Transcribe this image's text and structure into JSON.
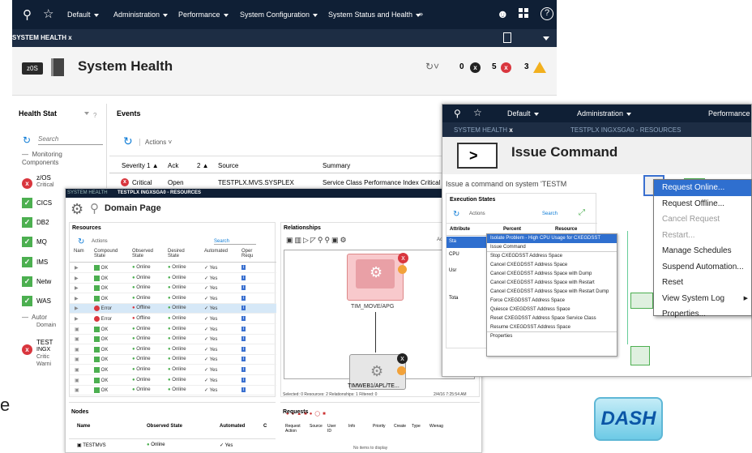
{
  "nav": {
    "default": "Default",
    "administration": "Administration",
    "performance": "Performance",
    "system_configuration": "System Configuration",
    "system_status": "System Status and Health",
    "more": "»",
    "help": "?"
  },
  "tab": {
    "label": "SYSTEM HEALTH",
    "close": "x"
  },
  "header": {
    "os_badge": "z0S",
    "title": "System Health",
    "count_crit": "0",
    "count_err": "5",
    "count_warn": "3"
  },
  "health_states": {
    "title": "Health Stat",
    "search_placeholder": "Search",
    "items": [
      {
        "label": "Monitoring Components"
      },
      {
        "label": "z/OS",
        "sub": "Critical"
      },
      {
        "label": "CICS"
      },
      {
        "label": "DB2"
      },
      {
        "label": "MQ"
      },
      {
        "label": "IMS"
      },
      {
        "label": "Netw"
      },
      {
        "label": "WAS"
      },
      {
        "label": "Autor",
        "sub": "Domain"
      },
      {
        "label": "TEST",
        "sub": "INGX",
        "sub2": "Critic",
        "sub3": "Warni"
      }
    ]
  },
  "events": {
    "title": "Events",
    "actions": "Actions",
    "headers": [
      "Severity 1",
      "Ack",
      "2",
      "Source",
      "Summary"
    ],
    "row": {
      "severity": "Critical",
      "ack": "Open",
      "source": "TESTPLX.MVS.SYSPLEX",
      "summary": "Service Class Performance Index Critical"
    }
  },
  "domain": {
    "tab1": "SYSTEM HEALTH",
    "tab2": "TESTPLX INGXSGA0 - RESOURCES",
    "title": "Domain Page",
    "resources": {
      "title": "Resources",
      "actions": "Actions",
      "search": "Search",
      "headers": [
        "Nam",
        "Compound State",
        "Observed State",
        "Desired State",
        "Automated",
        "Oper Requ"
      ],
      "rows": [
        {
          "c": "OK",
          "o": "Online",
          "d": "Online",
          "a": "Yes"
        },
        {
          "c": "OK",
          "o": "Online",
          "d": "Online",
          "a": "Yes"
        },
        {
          "c": "OK",
          "o": "Online",
          "d": "Online",
          "a": "Yes"
        },
        {
          "c": "OK",
          "o": "Online",
          "d": "Online",
          "a": "Yes"
        },
        {
          "c": "Error",
          "o": "Offline",
          "d": "Online",
          "a": "Yes",
          "sel": true
        },
        {
          "c": "Error",
          "o": "Offline",
          "d": "Online",
          "a": "Yes"
        },
        {
          "c": "OK",
          "o": "Online",
          "d": "Online",
          "a": "Yes"
        },
        {
          "c": "OK",
          "o": "Online",
          "d": "Online",
          "a": "Yes"
        },
        {
          "c": "OK",
          "o": "Online",
          "d": "Online",
          "a": "Yes"
        },
        {
          "c": "OK",
          "o": "Online",
          "d": "Online",
          "a": "Yes"
        },
        {
          "c": "OK",
          "o": "Online",
          "d": "Online",
          "a": "Yes"
        },
        {
          "c": "OK",
          "o": "Online",
          "d": "Online",
          "a": "Yes"
        },
        {
          "c": "OK",
          "o": "Online",
          "d": "Online",
          "a": "Yes"
        }
      ]
    },
    "relationships": {
      "title": "Relationships",
      "actions": "Action",
      "node1": "TIM_MOVE/APG",
      "node2": "TIMWEB1/APL/TE...",
      "status": "Selected: 0 Resources: 2 Relationships: 1 Filtered: 0",
      "time": "2/4/16 7:25:54 AM"
    },
    "nodes": {
      "title": "Nodes",
      "headers": [
        "Name",
        "Observed State",
        "Automated",
        "C"
      ],
      "row": {
        "name": "TESTMVS",
        "state": "Online",
        "auto": "Yes"
      }
    },
    "requests": {
      "title": "Requests",
      "headers": [
        "Request Action",
        "Source",
        "User ID",
        "Info",
        "Priority",
        "Create",
        "Type",
        "Wienag"
      ],
      "empty": "No items to display"
    }
  },
  "issue": {
    "tab1": "SYSTEM HEALTH",
    "tab2": "TESTPLX INGXSGA0 - RESOURCES",
    "title": "Issue Command",
    "subtitle": "Issue a command on system 'TESTM",
    "exec": {
      "title": "Execution States",
      "actions": "Actions",
      "search": "Search",
      "headers": [
        "Attribute",
        "Percent",
        "Resource"
      ],
      "rows": [
        "Sta",
        "CPU",
        "Usr",
        "Tota"
      ]
    }
  },
  "cmd_menu": [
    "Isolate Problem - High CPU Usage for CXEGDSST",
    "Issue Command",
    "Stop CXEGDSST Address Space",
    "Cancel CXEGDSST Address Space",
    "Cancel CXEGDSST Address Space with Dump",
    "Cancel CXEGDSST Address Space with Restart",
    "Cancel CXEGDSST Address Space with Restart Dump",
    "Force CXEGDSST Address Space",
    "Quiesce CXEGDSST Address Space",
    "Reset CXEGDSST Address Space Service Class",
    "Resume CXEGDSST Address Space",
    "Properties"
  ],
  "ctx_menu": [
    "Request Online...",
    "Request Offline...",
    "Cancel Request",
    "Restart...",
    "Manage Schedules",
    "Suspend Automation...",
    "Reset",
    "View System Log",
    "Properties..."
  ],
  "dash": "DASH",
  "left_fragment": "e",
  "colors": {
    "nav": "#0f1f35",
    "accent": "#0c7bd6",
    "ok": "#4caf50",
    "error": "#d9363e",
    "warn": "#f2b01e",
    "highlight": "#2f6fcf"
  }
}
